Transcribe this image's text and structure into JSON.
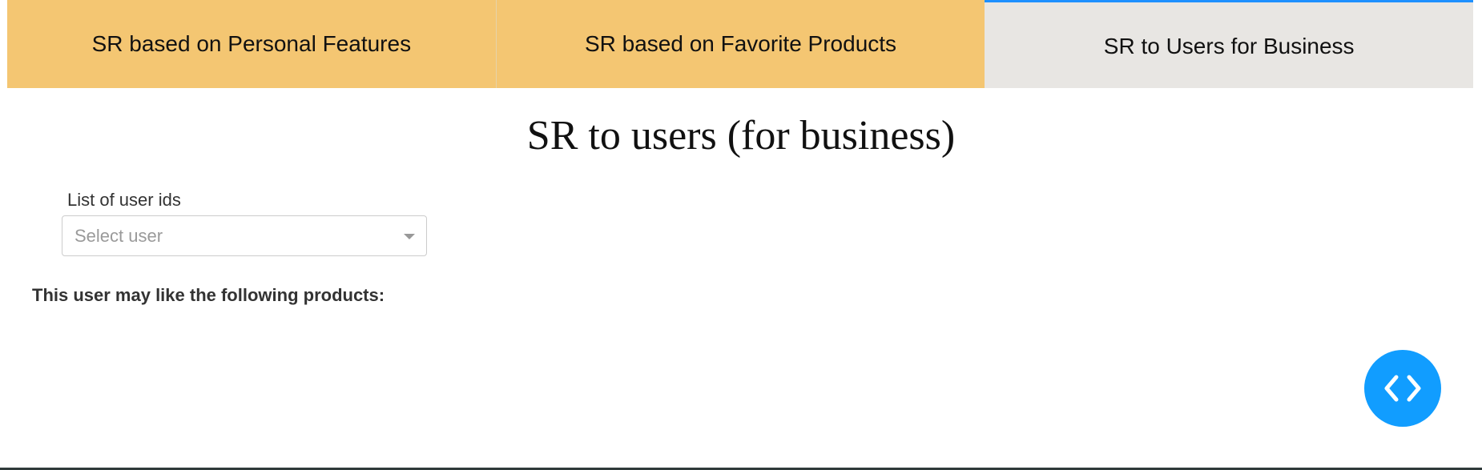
{
  "tabs": [
    {
      "label": "SR based on Personal Features"
    },
    {
      "label": "SR based on Favorite Products"
    },
    {
      "label": "SR to Users for Business"
    }
  ],
  "colors": {
    "tab_inactive_bg": "#f4c672",
    "tab_active_bg": "#e8e6e3",
    "tab_active_accent": "#1e90ff",
    "fab_bg": "#119dff"
  },
  "main": {
    "title": "SR to users (for business)",
    "user_select": {
      "label": "List of user ids",
      "placeholder": "Select user"
    },
    "results_label": "This user may like the following products:"
  },
  "fab": {
    "icon": "code-icon"
  }
}
